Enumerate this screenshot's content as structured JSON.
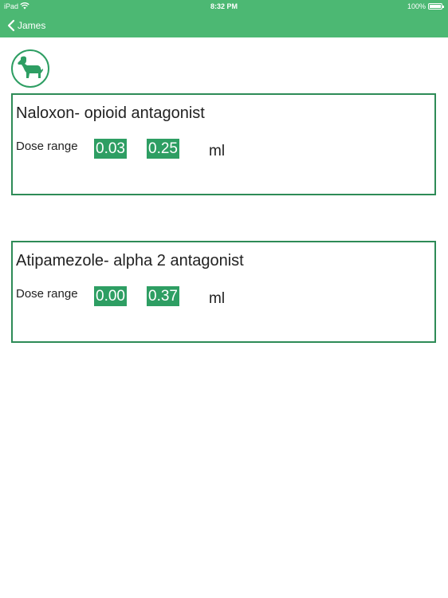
{
  "status_bar": {
    "carrier": "iPad",
    "time": "8:32 PM",
    "battery": "100%"
  },
  "nav": {
    "back_label": "James"
  },
  "icons": {
    "back": "chevron-left-icon",
    "pet": "dog-icon"
  },
  "colors": {
    "accent": "#4cb873",
    "value_bg": "#2e9e63",
    "border": "#2e8b57"
  },
  "drugs": [
    {
      "title": "Naloxon- opioid antagonist",
      "dose_label": "Dose range",
      "min": "0.03",
      "max": "0.25",
      "unit": "ml"
    },
    {
      "title": "Atipamezole- alpha 2 antagonist",
      "dose_label": "Dose range",
      "min": "0.00",
      "max": "0.37",
      "unit": "ml"
    }
  ]
}
